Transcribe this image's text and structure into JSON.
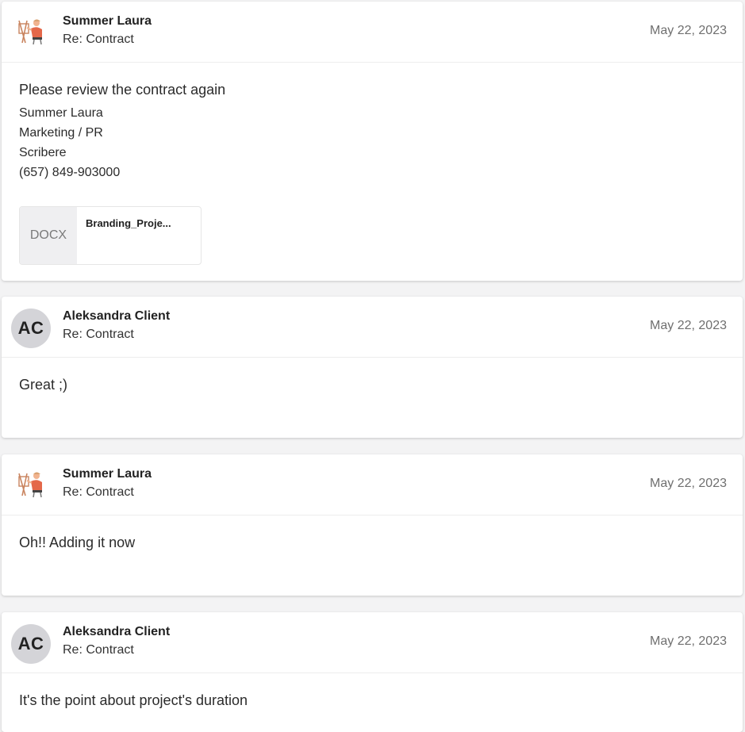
{
  "messages": [
    {
      "sender": "Summer Laura",
      "subject": "Re: Contract",
      "date": "May 22, 2023",
      "body": "Please review the contract again",
      "signature": [
        "Summer Laura",
        "Marketing / PR",
        "Scribere",
        "(657) 849-903000"
      ],
      "attachment": {
        "type": "DOCX",
        "name": "Branding_Proje..."
      }
    },
    {
      "sender": "Aleksandra Client",
      "initials": "AC",
      "subject": "Re: Contract",
      "date": "May 22, 2023",
      "body": "Great ;)"
    },
    {
      "sender": "Summer Laura",
      "subject": "Re: Contract",
      "date": "May 22, 2023",
      "body": "Oh!! Adding it now"
    },
    {
      "sender": "Aleksandra Client",
      "initials": "AC",
      "subject": "Re: Contract",
      "date": "May 22, 2023",
      "body": "It's the point about project's duration"
    }
  ],
  "colors": {
    "avatar_bg": "#d4d4d8",
    "card_bg": "#ffffff",
    "page_bg": "#f3f3f4",
    "accent_illustration": "#e4684a"
  },
  "icons": {
    "sender_avatar": "painter-illustration-icon"
  }
}
